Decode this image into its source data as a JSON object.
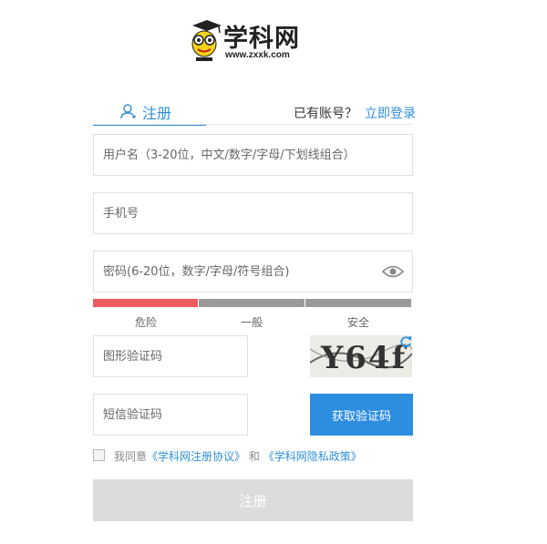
{
  "logo": {
    "text": "学科网",
    "url": "www.zxxk.com",
    "icon": "graduation-cap-mascot-icon"
  },
  "tabs": {
    "register_label": "注册",
    "register_icon": "user-add-icon",
    "have_account": "已有账号？",
    "login_link": "立即登录"
  },
  "form": {
    "username_placeholder": "用户名（3-20位，中文/数字/字母/下划线组合）",
    "phone_placeholder": "手机号",
    "password_placeholder": "密码(6-20位，数字/字母/符号组合)",
    "password_toggle_icon": "eye-icon",
    "strength": {
      "labels": [
        "危险",
        "一般",
        "安全"
      ],
      "colors": [
        "#ee5a5e",
        "#9a9a9a",
        "#9a9a9a"
      ],
      "level": 1
    },
    "captcha_placeholder": "图形验证码",
    "captcha_text": "Y64f",
    "captcha_refresh_icon": "refresh-icon",
    "sms_placeholder": "短信验证码",
    "sms_button": "获取验证码"
  },
  "agreement": {
    "prefix": "我同意",
    "link1": "《学科网注册协议》",
    "and": "和",
    "link2": "《学科网隐私政策》"
  },
  "submit_label": "注册",
  "colors": {
    "accent": "#2f8fd8",
    "danger": "#ee5a5e",
    "disabled": "#dcdcdc"
  }
}
